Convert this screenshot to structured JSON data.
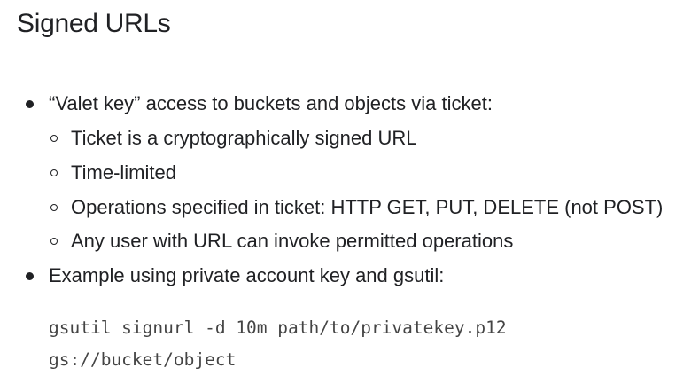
{
  "slide": {
    "title": "Signed URLs",
    "bullets": [
      {
        "text": "“Valet key” access to buckets and objects via ticket:",
        "sub": [
          "Ticket is a cryptographically signed URL",
          "Time-limited",
          "Operations specified in ticket: HTTP GET, PUT, DELETE (not POST)",
          "Any user with URL can invoke permitted operations"
        ]
      },
      {
        "text": "Example using private account key and gsutil:"
      }
    ],
    "code_lines": [
      "gsutil signurl -d 10m path/to/privatekey.p12",
      "gs://bucket/object"
    ]
  }
}
